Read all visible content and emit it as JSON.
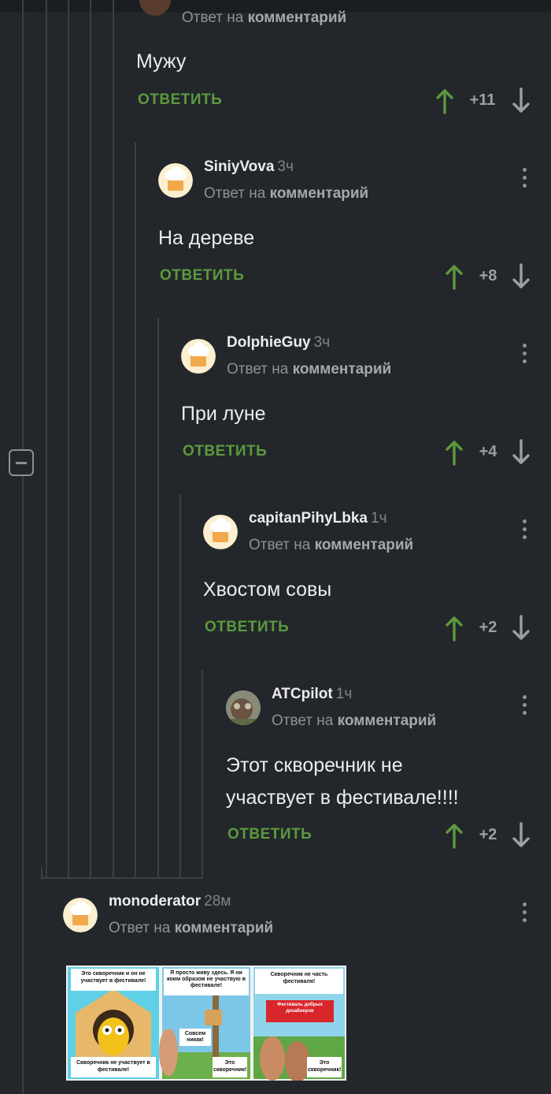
{
  "colors": {
    "background": "#23272b",
    "accent_green": "#5c9a3d",
    "thread_line": "#3b4046"
  },
  "thread": {
    "top_fragment": {
      "reply_to_prefix": "Ответ на",
      "reply_to_link": "комментарий",
      "text": "Мужу",
      "reply_label": "ОТВЕТИТЬ",
      "score": "+11"
    },
    "comments": [
      {
        "username": "SiniyVova",
        "time": "3ч",
        "reply_to_prefix": "Ответ на",
        "reply_to_link": "комментарий",
        "text": "На дереве",
        "reply_label": "ОТВЕТИТЬ",
        "score": "+8"
      },
      {
        "username": "DolphieGuy",
        "time": "3ч",
        "reply_to_prefix": "Ответ на",
        "reply_to_link": "комментарий",
        "text": "При луне",
        "reply_label": "ОТВЕТИТЬ",
        "score": "+4"
      },
      {
        "username": "capitanPihyLbka",
        "time": "1ч",
        "reply_to_prefix": "Ответ на",
        "reply_to_link": "комментарий",
        "text": "Хвостом совы",
        "reply_label": "ОТВЕТИТЬ",
        "score": "+2"
      },
      {
        "username": "ATCpilot",
        "time": "1ч",
        "reply_to_prefix": "Ответ на",
        "reply_to_link": "комментарий",
        "text_line1": "Этот скворечник не",
        "text_line2": "участвует в фестивале!!!!",
        "reply_label": "ОТВЕТИТЬ",
        "score": "+2"
      }
    ],
    "last_comment": {
      "username": "monoderator",
      "time": "28м",
      "reply_to_prefix": "Ответ на",
      "reply_to_link": "комментарий",
      "image_panels": [
        {
          "top": "Это скворечник и он не участвует в фестивале!",
          "bottom": "Скворечник не участвует в фестивале!"
        },
        {
          "top": "Я просто живу здесь. Я ни коим образом не участвую в фестивале!",
          "middle": "Совсем никак!",
          "bottom": "Это скворечник!"
        },
        {
          "top": "Скворечник не часть фестиваля!",
          "middle": "Фестиваль добрых дизайнеров",
          "bottom": "Это скворечник!"
        }
      ]
    }
  },
  "icons": {
    "upvote": "arrow-up-icon",
    "downvote": "arrow-down-icon",
    "menu": "vertical-dots-icon",
    "collapse": "minus-square-icon",
    "avatar_default": "chef-hat-avatar-icon"
  }
}
